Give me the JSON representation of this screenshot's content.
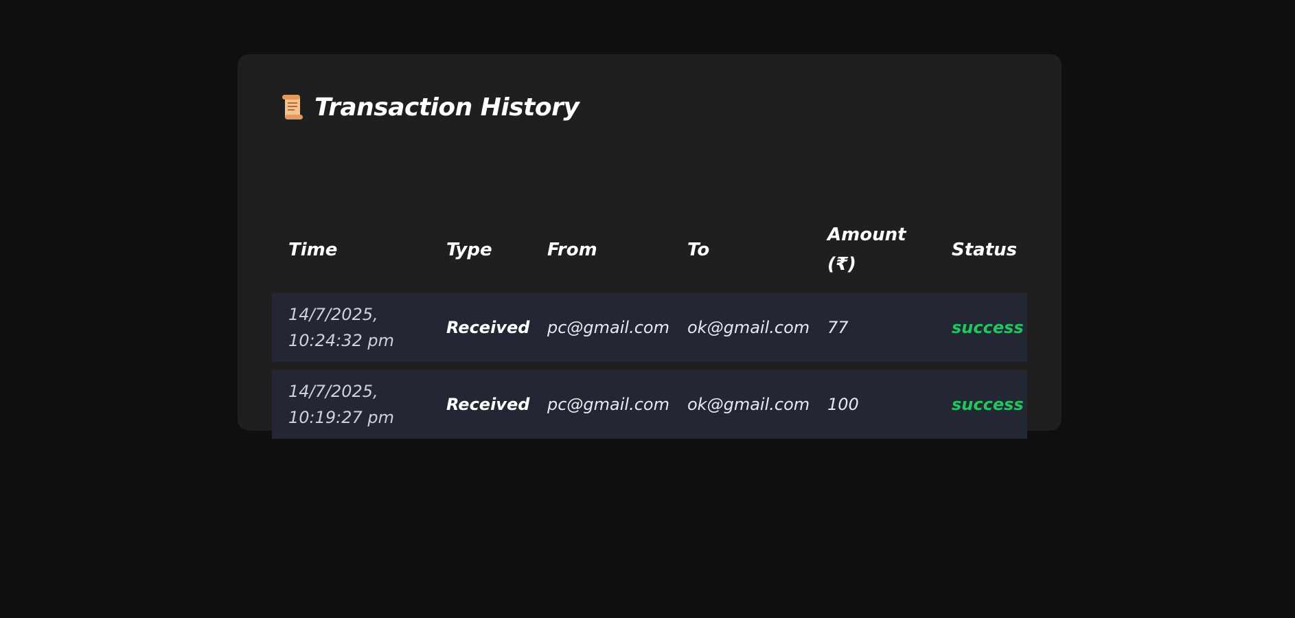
{
  "header": {
    "title": "Transaction History",
    "icon": "scroll-icon"
  },
  "table": {
    "columns": [
      "Time",
      "Type",
      "From",
      "To",
      "Amount (₹)",
      "Status"
    ],
    "rows": [
      {
        "time": "14/7/2025, 10:24:32 pm",
        "type": "Received",
        "from": "pc@gmail.com",
        "to": "ok@gmail.com",
        "amount": "77",
        "status": "success"
      },
      {
        "time": "14/7/2025, 10:19:27 pm",
        "type": "Received",
        "from": "pc@gmail.com",
        "to": "ok@gmail.com",
        "amount": "100",
        "status": "success"
      }
    ]
  },
  "colors": {
    "background": "#0f0f0f",
    "card": "#1f1f1f",
    "row": "#222733",
    "success": "#22c55e",
    "text": "#ffffff"
  }
}
